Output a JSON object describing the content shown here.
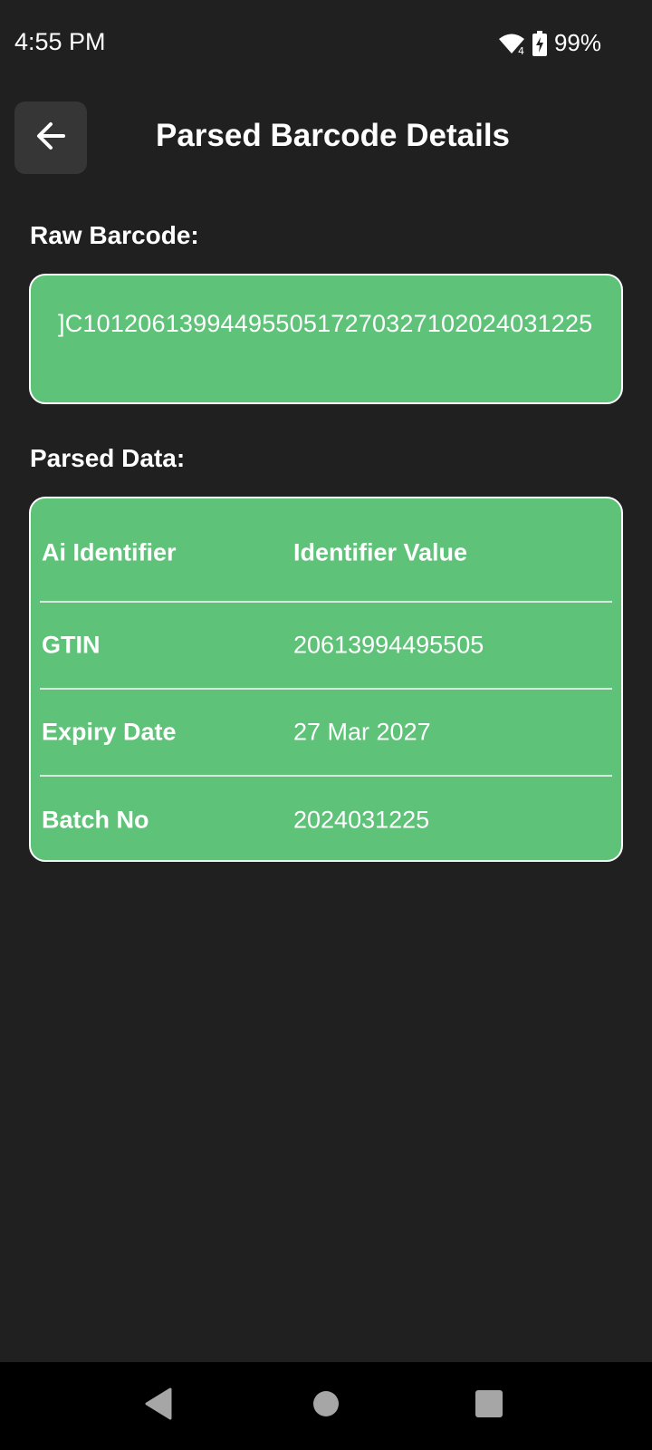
{
  "status_bar": {
    "time": "4:55 PM",
    "wifi_icon": "wifi-icon",
    "battery_icon": "battery-charging-icon",
    "battery_percent": "99%"
  },
  "app_bar": {
    "back_icon": "arrow-back-icon",
    "title": "Parsed Barcode Details"
  },
  "raw_section": {
    "label": "Raw Barcode:",
    "value": "]C1012061399449550517270327102024031225"
  },
  "parsed_section": {
    "label": "Parsed Data:",
    "columns": [
      "Ai Identifier",
      "Identifier Value"
    ],
    "rows": [
      {
        "identifier": "GTIN",
        "value": "20613994495505"
      },
      {
        "identifier": "Expiry Date",
        "value": "27 Mar 2027"
      },
      {
        "identifier": "Batch No",
        "value": "2024031225"
      }
    ]
  },
  "nav_bar": {
    "back": "nav-back-icon",
    "home": "nav-home-icon",
    "recents": "nav-recents-icon"
  },
  "colors": {
    "background": "#202020",
    "card": "#5ec278",
    "card_border": "#ffffff",
    "back_button": "#363636",
    "nav_bar": "#000000"
  }
}
